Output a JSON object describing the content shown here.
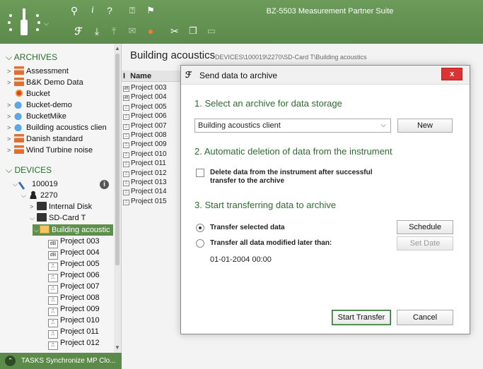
{
  "window": {
    "title": "BZ-5503 Measurement Partner Suite"
  },
  "toolbar": {
    "icons": [
      "wrench-icon",
      "info-icon",
      "help-icon",
      "quick-help-icon",
      "pin-icon",
      "send-to-archive-icon",
      "download-icon",
      "upload-icon",
      "mail-icon",
      "bucket-icon",
      "cut-icon",
      "copy-icon",
      "paste-icon"
    ],
    "glyphs": {
      "wrench": "⚲",
      "info": "i",
      "help": "?",
      "quickhelp": "⍰",
      "pin": "⚑",
      "send": "ℱ",
      "download": "⤓",
      "upload": "⤒",
      "mail": "✉",
      "bucket": "●",
      "cut": "✂",
      "copy": "❐",
      "paste": "▭"
    }
  },
  "sidebar": {
    "archives_label": "ARCHIVES",
    "archives": [
      {
        "label": "Assessment",
        "icon": "archive-icon"
      },
      {
        "label": "B&K Demo Data",
        "icon": "archive-icon"
      },
      {
        "label": "Bucket",
        "icon": "bucket-icon"
      },
      {
        "label": "Bucket-demo",
        "icon": "cloud-icon"
      },
      {
        "label": "BucketMike",
        "icon": "cloud-icon"
      },
      {
        "label": "Building acoustics clien",
        "icon": "cloud-icon"
      },
      {
        "label": "Danish standard",
        "icon": "archive-icon"
      },
      {
        "label": "Wind Turbine noise",
        "icon": "archive-icon"
      }
    ],
    "devices_label": "DEVICES",
    "device_id": "100019",
    "instrument": "2270",
    "internal_disk": "Internal Disk",
    "sd_card": "SD-Card T",
    "selected_folder": "Building acoustic",
    "projects": [
      {
        "badge": "dB",
        "label": "Project 003"
      },
      {
        "badge": "dB",
        "label": "Project 004"
      },
      {
        "badge": "⎍",
        "label": "Project 005"
      },
      {
        "badge": "⎍",
        "label": "Project 006"
      },
      {
        "badge": "⎍",
        "label": "Project 007"
      },
      {
        "badge": "⎍",
        "label": "Project 008"
      },
      {
        "badge": "⎍",
        "label": "Project 009"
      },
      {
        "badge": "⎍",
        "label": "Project 010"
      },
      {
        "badge": "⎍",
        "label": "Project 011"
      },
      {
        "badge": "⎍",
        "label": "Project 012"
      }
    ],
    "tasks_label": "TASKS",
    "tasks_text": "Synchronize MP Clo..."
  },
  "content": {
    "title": "Building acoustics",
    "path": "DEVICES\\100019\\2270\\SD-Card T\\Building acoustics",
    "col_i": "I",
    "col_name": "Name",
    "rows": [
      "Project 003",
      "Project 004",
      "Project 005",
      "Project 006",
      "Project 007",
      "Project 008",
      "Project 009",
      "Project 010",
      "Project 011",
      "Project 012",
      "Project 013",
      "Project 014",
      "Project 015"
    ]
  },
  "dialog": {
    "title": "Send data to archive",
    "close": "x",
    "step1": "1. Select an archive for data storage",
    "archive_value": "Building acoustics client",
    "new_button": "New",
    "step2": "2. Automatic deletion of data from the instrument",
    "delete_label": "Delete data from the instrument after successful transfer to the archive",
    "delete_checked": false,
    "step3": "3. Start transferring data to archive",
    "radio_selected_label": "Transfer selected data",
    "radio_modified_label": "Transfer all data modified later than:",
    "schedule_button": "Schedule",
    "set_date_button": "Set Date",
    "date_value": "01-01-2004 00:00",
    "start_button": "Start Transfer",
    "cancel_button": "Cancel"
  }
}
